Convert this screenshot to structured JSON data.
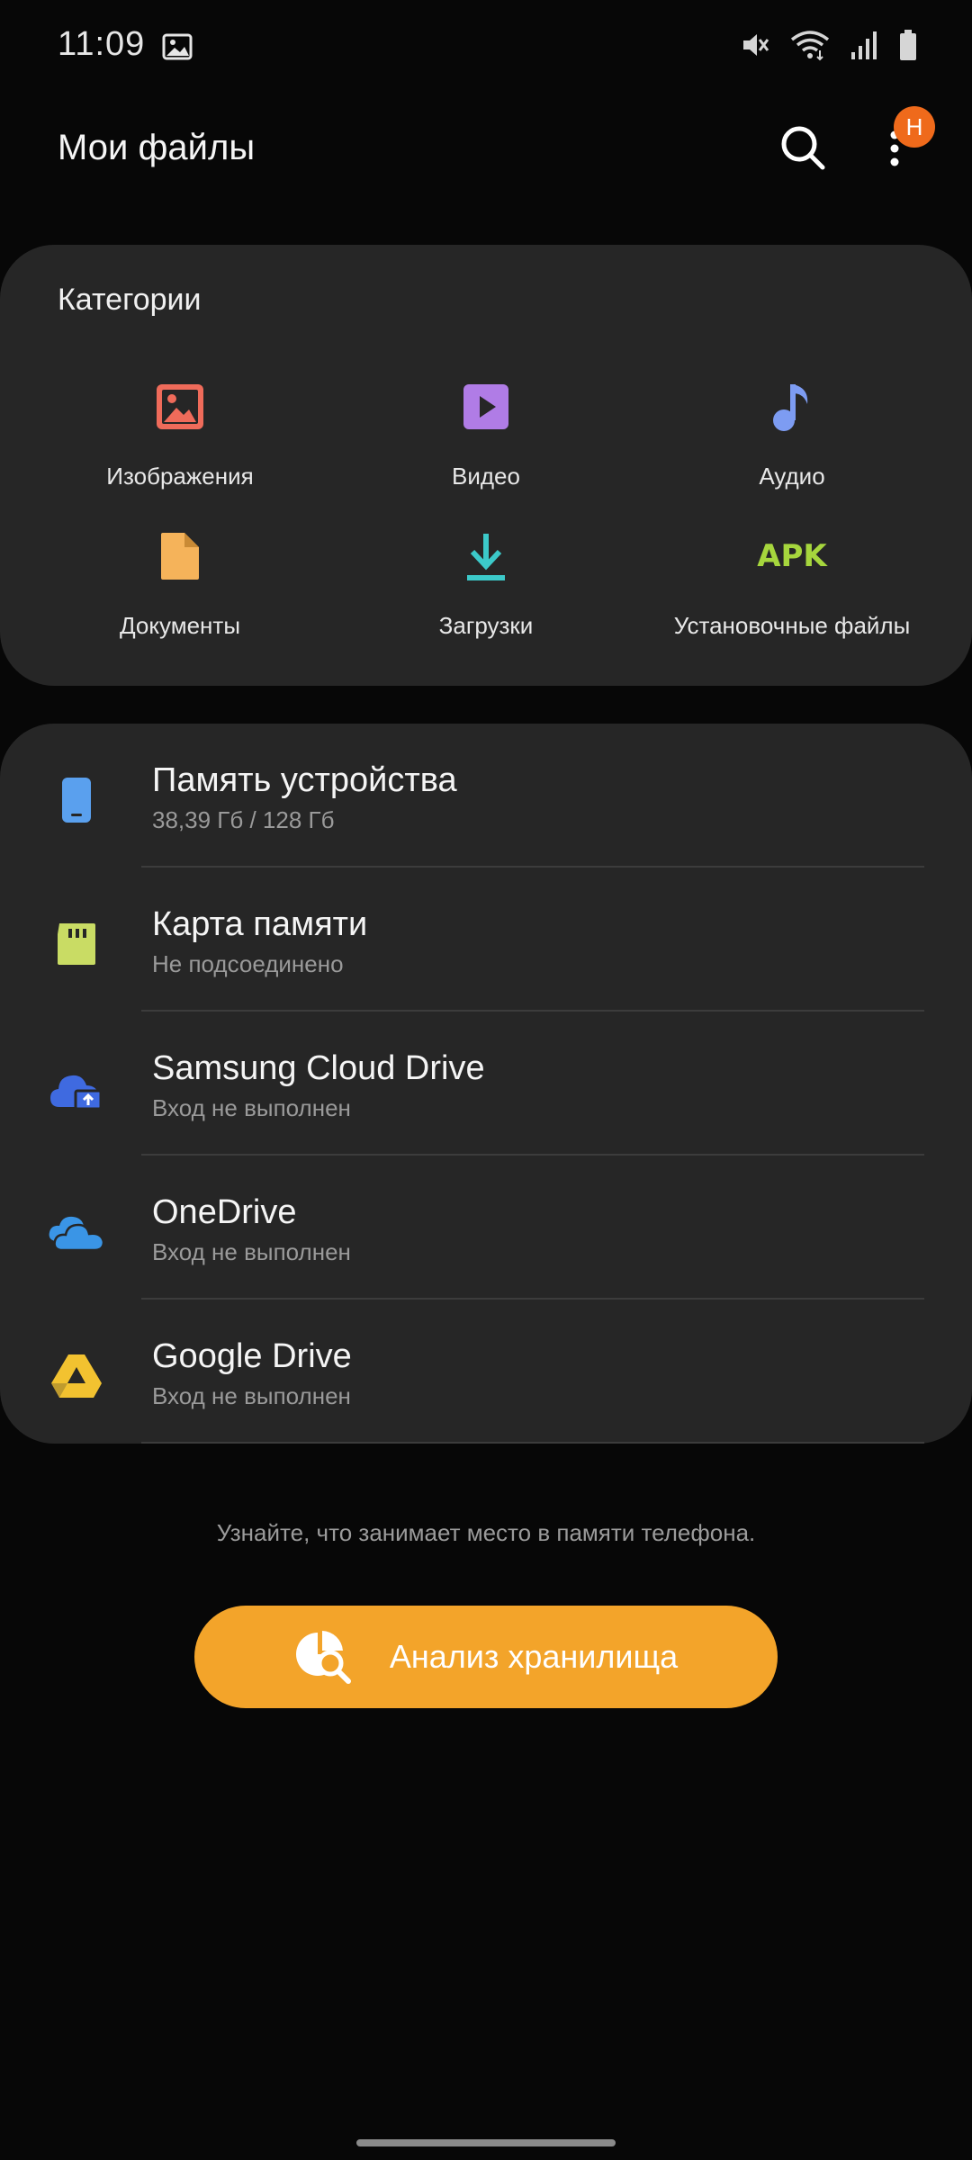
{
  "status_bar": {
    "time": "11:09",
    "icons": [
      "gallery-icon",
      "mute-icon",
      "wifi-icon",
      "signal-icon",
      "battery-icon"
    ]
  },
  "app_bar": {
    "title": "Мои файлы",
    "search_icon": "search-icon",
    "more_icon": "more-vert-icon",
    "badge": "Н"
  },
  "categories": {
    "title": "Категории",
    "items": [
      {
        "label": "Изображения",
        "icon": "image-icon",
        "color": "#ef6b5a"
      },
      {
        "label": "Видео",
        "icon": "video-icon",
        "color": "#b07ce6"
      },
      {
        "label": "Аудио",
        "icon": "audio-icon",
        "color": "#7d9cf2"
      },
      {
        "label": "Документы",
        "icon": "document-icon",
        "color": "#f5b35a"
      },
      {
        "label": "Загрузки",
        "icon": "download-icon",
        "color": "#3cc9c9"
      },
      {
        "label": "Установочные файлы",
        "icon": "apk-icon",
        "icon_text": "APK",
        "color": "#a6d63d"
      }
    ]
  },
  "storage": {
    "items": [
      {
        "title": "Память устройства",
        "subtitle": "38,39 Гб / 128 Гб",
        "icon": "phone-icon",
        "color": "#5aa0ee"
      },
      {
        "title": "Карта памяти",
        "subtitle": "Не подсоединено",
        "icon": "sd-card-icon",
        "color": "#c9dc64"
      },
      {
        "title": "Samsung Cloud Drive",
        "subtitle": "Вход не выполнен",
        "icon": "samsung-cloud-icon",
        "color": "#3f6ae0"
      },
      {
        "title": "OneDrive",
        "subtitle": "Вход не выполнен",
        "icon": "onedrive-icon",
        "color": "#3a95e6"
      },
      {
        "title": "Google Drive",
        "subtitle": "Вход не выполнен",
        "icon": "google-drive-icon",
        "color": "#f2c230"
      }
    ]
  },
  "hint": "Узнайте, что занимает место в памяти телефона.",
  "analyze_button": {
    "label": "Анализ хранилища",
    "icon": "storage-analysis-icon",
    "color": "#f3a42a"
  }
}
